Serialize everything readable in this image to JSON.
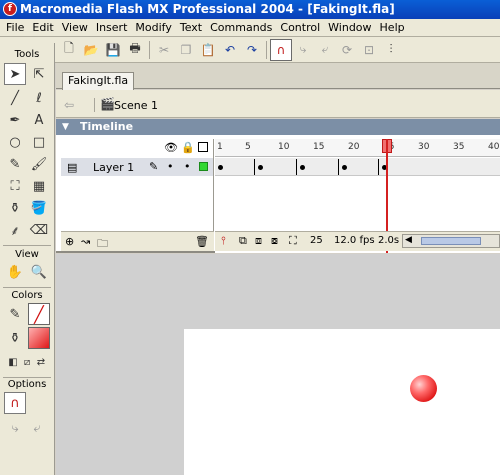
{
  "window": {
    "title": "Macromedia Flash MX Professional 2004 - [FakingIt.fla]"
  },
  "menu": [
    "File",
    "Edit",
    "View",
    "Insert",
    "Modify",
    "Text",
    "Commands",
    "Control",
    "Window",
    "Help"
  ],
  "tools_panel": {
    "header": "Tools",
    "view_header": "View",
    "colors_header": "Colors",
    "options_header": "Options"
  },
  "document": {
    "tab_label": "FakingIt.fla",
    "scene_label": "Scene 1"
  },
  "timeline": {
    "title": "Timeline",
    "layer_name": "Layer 1",
    "ruler_numbers": [
      "1",
      "5",
      "10",
      "15",
      "20",
      "25",
      "30",
      "35",
      "40"
    ],
    "current_frame": "25",
    "frame_rate": "12.0 fps",
    "elapsed_time": "2.0s"
  },
  "colors": {
    "accent_title": "#0a4fc8",
    "timeline_header": "#7c8fa6",
    "playhead": "#d42020",
    "ball": "#e01818"
  }
}
